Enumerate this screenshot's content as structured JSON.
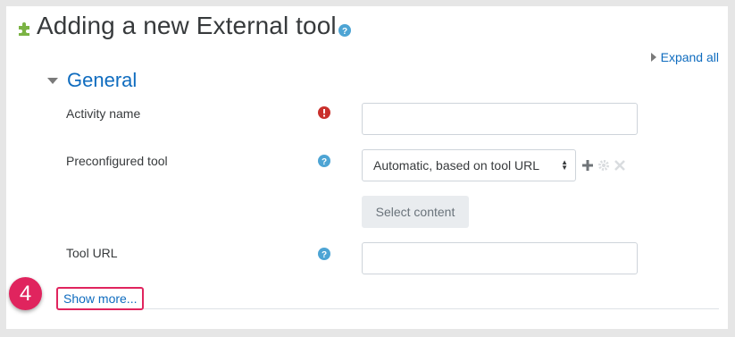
{
  "page": {
    "title": "Adding a new External tool",
    "expand_all": "Expand all"
  },
  "section": {
    "title": "General"
  },
  "fields": {
    "activity_name": {
      "label": "Activity name",
      "value": ""
    },
    "preconfigured_tool": {
      "label": "Preconfigured tool",
      "selected": "Automatic, based on tool URL"
    },
    "select_content": "Select content",
    "tool_url": {
      "label": "Tool URL",
      "value": ""
    }
  },
  "show_more": "Show more...",
  "annotation": {
    "step": "4"
  },
  "colors": {
    "link": "#0f6cbf",
    "required": "#c9302c",
    "help": "#4da4d4",
    "highlight": "#e0245e"
  },
  "icons": [
    "puzzle-icon",
    "help-icon",
    "expand-arrow-icon",
    "collapse-arrow-icon",
    "required-icon",
    "add-icon",
    "gear-icon",
    "delete-icon"
  ]
}
